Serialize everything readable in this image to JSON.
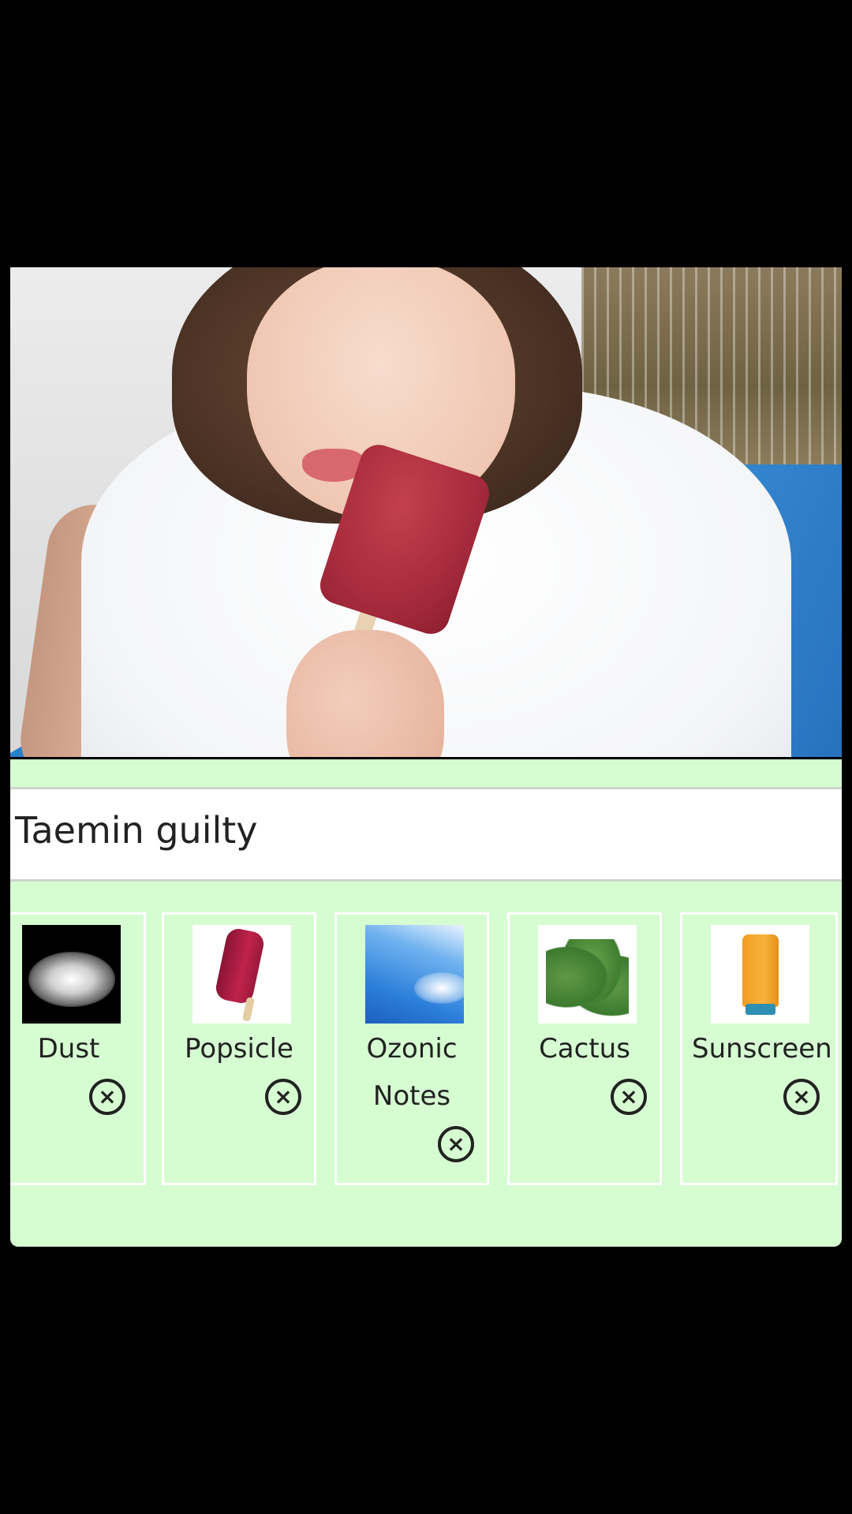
{
  "post": {
    "title": "Taemin guilty"
  },
  "notes": [
    {
      "label": "Dust",
      "image": "dust-image",
      "remove_icon": "close-circle-icon"
    },
    {
      "label": "Popsicle",
      "image": "popsicle-image",
      "remove_icon": "close-circle-icon"
    },
    {
      "label": "Ozonic Notes",
      "image": "sky-image",
      "remove_icon": "close-circle-icon"
    },
    {
      "label": "Cactus",
      "image": "cactus-image",
      "remove_icon": "close-circle-icon"
    },
    {
      "label": "Sunscreen",
      "image": "sunscreen-image",
      "remove_icon": "close-circle-icon"
    }
  ],
  "colors": {
    "panel_bg": "#d6fdd2",
    "title_bg": "#ffffff",
    "text": "#222222",
    "screen_bg": "#000000"
  }
}
